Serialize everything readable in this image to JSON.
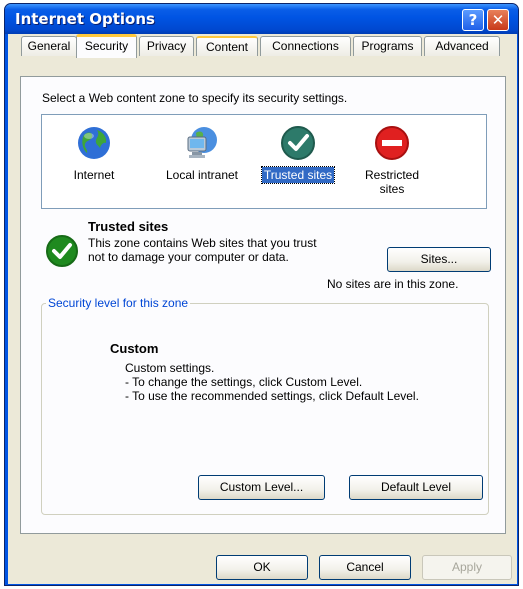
{
  "window": {
    "title": "Internet Options",
    "help_glyph": "?",
    "close_glyph": "✕"
  },
  "tabs": [
    "General",
    "Security",
    "Privacy",
    "Content",
    "Connections",
    "Programs",
    "Advanced"
  ],
  "active_tab": "Security",
  "security": {
    "instruction": "Select a Web content zone to specify its security settings.",
    "zones": [
      {
        "label": "Internet",
        "icon": "globe-icon"
      },
      {
        "label": "Local intranet",
        "icon": "computer-icon"
      },
      {
        "label": "Trusted sites",
        "icon": "check-icon",
        "selected": true
      },
      {
        "label": "Restricted sites",
        "icon": "restricted-icon"
      }
    ],
    "selected_zone": {
      "title": "Trusted sites",
      "description": "This zone contains Web sites that you trust not to damage your computer or data.",
      "sites_button": "Sites...",
      "no_sites_text": "No sites are in this zone."
    },
    "level_group": {
      "legend": "Security level for this zone",
      "level_title": "Custom",
      "lines": [
        "Custom settings.",
        "- To change the settings, click Custom Level.",
        "- To use the recommended settings, click Default Level."
      ],
      "custom_level_button": "Custom Level...",
      "default_level_button": "Default Level"
    }
  },
  "footer": {
    "ok": "OK",
    "cancel": "Cancel",
    "apply": "Apply"
  },
  "colors": {
    "titlebar": "#0054e3",
    "selection": "#316ac5",
    "legend": "#0046d5",
    "trusted_green": "#1f8a1f",
    "restricted_red": "#e02020"
  }
}
